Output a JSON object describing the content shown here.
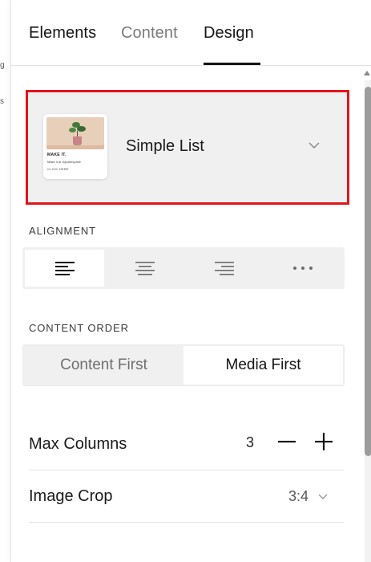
{
  "edge_marks": [
    "g",
    "s"
  ],
  "tabs": [
    {
      "label": "Elements",
      "active": false
    },
    {
      "label": "Content",
      "active": false
    },
    {
      "label": "Design",
      "active": true
    }
  ],
  "layout": {
    "name": "Simple List",
    "thumbnail": {
      "title": "MAKE IT.",
      "subtitle": "Make it at Squarespace",
      "cta": "CLICK HERE"
    }
  },
  "alignment": {
    "label": "ALIGNMENT",
    "options": [
      "align-left-icon",
      "align-center-icon",
      "align-right-icon",
      "more-icon"
    ],
    "selected": "align-left-icon"
  },
  "content_order": {
    "label": "CONTENT ORDER",
    "options": [
      "Content First",
      "Media First"
    ],
    "selected": "Media First"
  },
  "max_columns": {
    "label": "Max Columns",
    "value": "3"
  },
  "image_crop": {
    "label": "Image Crop",
    "value": "3:4"
  },
  "colors": {
    "highlight_border": "#e3141b",
    "panel_bg": "#f0f0f0",
    "text": "#1a1a1a",
    "muted": "#7b7b7b"
  }
}
